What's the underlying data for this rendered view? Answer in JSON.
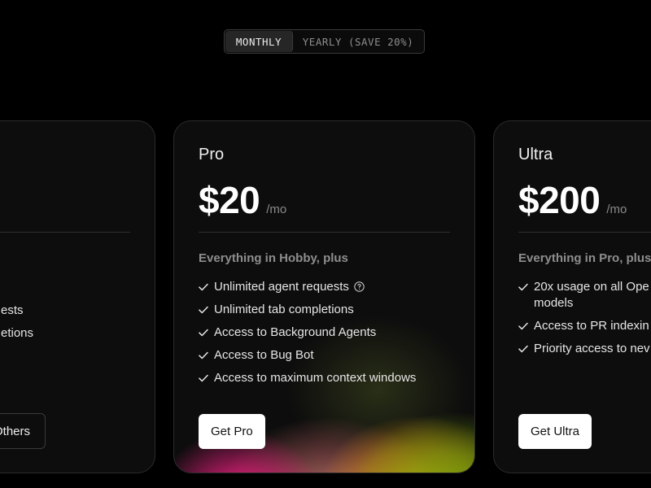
{
  "billing_toggle": {
    "monthly_label": "MONTHLY",
    "yearly_label": "YEARLY (SAVE 20%)",
    "selected": "monthly"
  },
  "hobby": {
    "features_partial": [
      "ests",
      "etions"
    ],
    "cta_label": "Others"
  },
  "pro": {
    "name": "Pro",
    "price": "$20",
    "period": "/mo",
    "features_heading": "Everything in Hobby, plus",
    "features": [
      "Unlimited agent requests",
      "Unlimited tab completions",
      "Access to Background Agents",
      "Access to Bug Bot",
      "Access to maximum context windows"
    ],
    "cta_label": "Get Pro"
  },
  "ultra": {
    "name": "Ultra",
    "price": "$200",
    "period": "/mo",
    "features_heading": "Everything in Pro, plus",
    "features": [
      "20x usage on all Ope models",
      "Access to PR indexin",
      "Priority access to nev"
    ],
    "cta_label": "Get Ultra"
  },
  "colors": {
    "background": "#000000",
    "card_bg": "#0d0d0d",
    "card_border": "#2b2b2b",
    "muted_text": "#8e8e8e",
    "cta_bg": "#ffffff",
    "glow_pink": "#e8288c",
    "glow_orange": "#e6961a",
    "glow_green": "#76aa0a"
  },
  "icons": {
    "feature_bullet": "check-icon",
    "info": "question-circle-icon"
  }
}
